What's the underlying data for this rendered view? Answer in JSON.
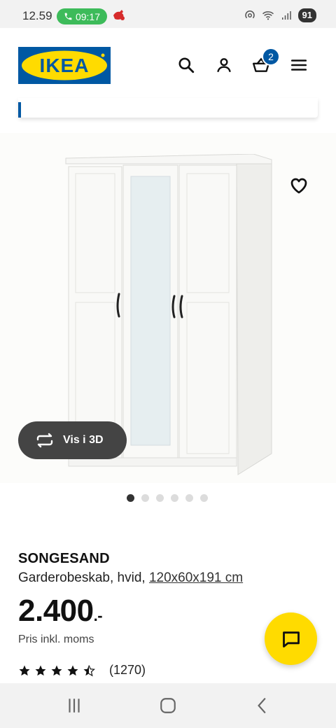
{
  "status_bar": {
    "time": "12.59",
    "call_timer": "09:17",
    "battery": "91"
  },
  "header": {
    "logo_text": "IKEA",
    "cart_count": "2",
    "brand_blue": "#0058a3",
    "brand_yellow": "#ffdb00"
  },
  "product": {
    "view_3d_label": "Vis i 3D",
    "image_count": 6,
    "active_image": 1,
    "name": "SONGESAND",
    "description": "Garderobeskab, hvid,",
    "dimensions": "120x60x191 cm",
    "price_main": "2.400",
    "price_suffix": ".-",
    "price_note": "Pris inkl. moms",
    "rating_value": 4.5,
    "rating_count": "(1270)"
  },
  "icons": {
    "search": "search-icon",
    "profile": "user-icon",
    "cart": "basket-icon",
    "menu": "hamburger-icon",
    "favourite": "heart-icon",
    "rotate": "rotate-3d-icon",
    "chat": "chat-icon"
  }
}
